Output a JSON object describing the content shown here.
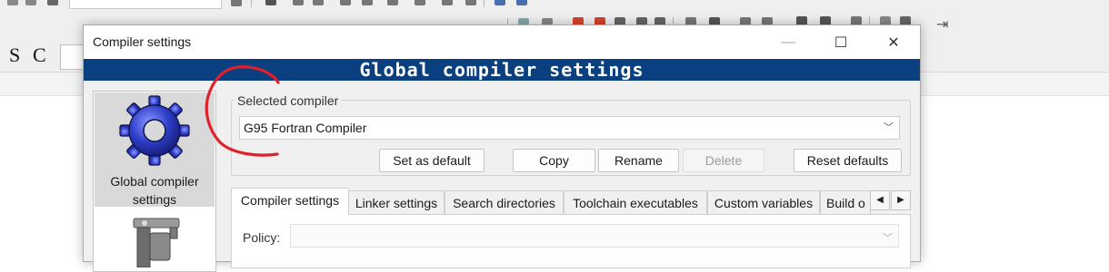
{
  "ide": {
    "toolbar_letters": [
      "S",
      "C"
    ]
  },
  "dialog": {
    "title": "Compiler settings",
    "banner": "Global compiler settings",
    "window_buttons": {
      "minimize": "—",
      "maximize": "☐",
      "close": "✕"
    },
    "sidebar": {
      "items": [
        {
          "label": "Global compiler settings",
          "icon": "gear-icon",
          "selected": true
        },
        {
          "label": "",
          "icon": "caliper-tool-icon",
          "selected": false
        }
      ]
    },
    "selected_compiler": {
      "group_label": "Selected compiler",
      "value": "G95 Fortran Compiler",
      "buttons": {
        "set_default": "Set as default",
        "copy": "Copy",
        "rename": "Rename",
        "delete": "Delete",
        "reset": "Reset defaults"
      }
    },
    "tabs": [
      {
        "label": "Compiler settings",
        "active": true
      },
      {
        "label": "Linker settings",
        "active": false
      },
      {
        "label": "Search directories",
        "active": false
      },
      {
        "label": "Toolchain executables",
        "active": false
      },
      {
        "label": "Custom variables",
        "active": false
      },
      {
        "label": "Build o",
        "active": false
      }
    ],
    "tab_scroll": {
      "left": "◀",
      "right": "▶"
    },
    "policy": {
      "label": "Policy:",
      "value": ""
    }
  },
  "colors": {
    "banner_bg": "#0a3f80",
    "banner_text": "#ffffff",
    "gear_blue": "#2d3cc8",
    "annotation_red": "#e0202a"
  }
}
